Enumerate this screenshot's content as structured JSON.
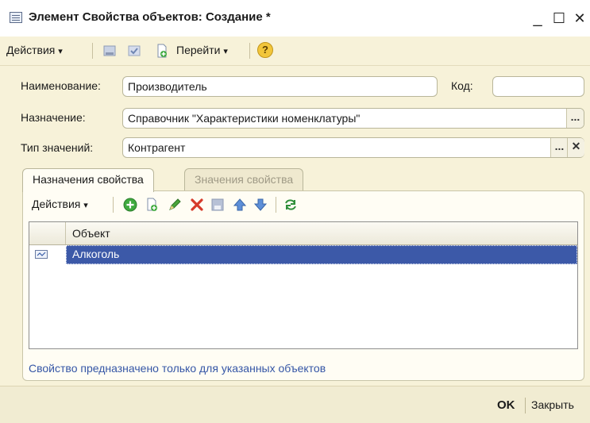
{
  "window": {
    "title": "Элемент Свойства объектов: Создание *",
    "minimize": "_",
    "maximize": "☐",
    "close": "✕"
  },
  "toolbar": {
    "actions_label": "Действия",
    "goto_label": "Перейти",
    "help_label": "?",
    "dropdown_arrow": "▾"
  },
  "form": {
    "name_label": "Наименование:",
    "name_value": "Производитель",
    "code_label": "Код:",
    "code_value": "",
    "purpose_label": "Назначение:",
    "purpose_value": "Справочник  \"Характеристики номенклатуры\"",
    "type_label": "Тип значений:",
    "type_value": "Контрагент",
    "select_button": "...",
    "clear_button": "✕"
  },
  "tabs": [
    {
      "label": "Назначения свойства",
      "active": true
    },
    {
      "label": "Значения свойства",
      "active": false
    }
  ],
  "grid_toolbar": {
    "actions_label": "Действия",
    "dropdown_arrow": "▾"
  },
  "grid": {
    "columns": [
      "Объект"
    ],
    "rows": [
      {
        "object": "Алкоголь",
        "selected": true
      }
    ]
  },
  "hint": "Свойство предназначено только для указанных объектов",
  "footer": {
    "ok_label": "OK",
    "close_label": "Закрыть"
  },
  "colors": {
    "background": "#f7f2d9",
    "selection": "#3c59a8",
    "link_text": "#3556a6",
    "add_green": "#3faa3f",
    "delete_red": "#d63a2a"
  }
}
